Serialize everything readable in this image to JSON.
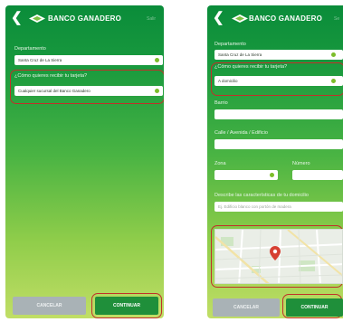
{
  "left_screen": {
    "header": {
      "brand": "BANCO GANADERO",
      "exit": "Salir"
    },
    "department_label": "Departamento",
    "department_value": "Santa Cruz de La Sierra",
    "delivery_label": "¿Cómo quieres recibir tu tarjeta?",
    "delivery_value": "Cualquier sucursal del Banco Ganadero",
    "cancel_label": "CANCELAR",
    "continue_label": "CONTINUAR"
  },
  "right_screen": {
    "header": {
      "brand": "BANCO GANADERO",
      "exit": "Se"
    },
    "department_label": "Departamento",
    "department_value": "Santa Cruz de La Sierra",
    "delivery_label": "¿Cómo quieres recibir tu tarjeta?",
    "delivery_value": "A domicilio",
    "barrio_label": "Barrio",
    "street_label": "Calle / Avenida / Edificio",
    "zone_label": "Zona",
    "number_label": "Número",
    "describe_label": "Describe las características de tu domicilio",
    "describe_placeholder": "Ej. Edificio blanco con portón de madera",
    "cancel_label": "CANCELAR",
    "continue_label": "CONTINUAR"
  },
  "colors": {
    "accent_green": "#1f8f3a",
    "highlight_red": "#c0302a",
    "dropdown_dot": "#7cbd2a"
  }
}
